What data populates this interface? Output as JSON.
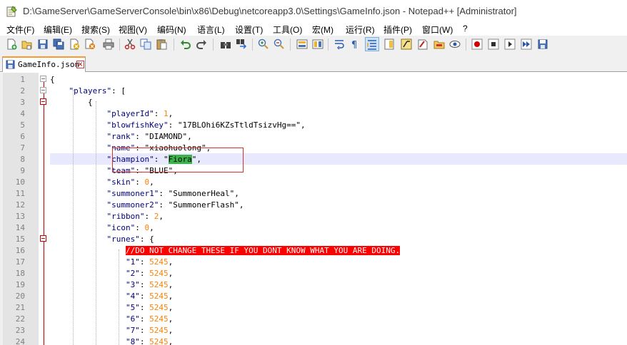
{
  "window": {
    "title": "D:\\GameServer\\GameServerConsole\\bin\\x86\\Debug\\netcoreapp3.0\\Settings\\GameInfo.json - Notepad++ [Administrator]"
  },
  "menu": [
    "文件(F)",
    "编辑(E)",
    "搜索(S)",
    "视图(V)",
    "编码(N)",
    "语言(L)",
    "设置(T)",
    "工具(O)",
    "宏(M)",
    "运行(R)",
    "插件(P)",
    "窗口(W)",
    "?"
  ],
  "toolbar": {
    "icons": [
      "new-file-icon",
      "open-file-icon",
      "save-icon",
      "save-all-icon",
      "close-icon",
      "close-all-icon",
      "print-icon",
      "cut-icon",
      "copy-icon",
      "paste-icon",
      "undo-icon",
      "redo-icon",
      "find-icon",
      "replace-icon",
      "zoom-in-icon",
      "zoom-out-icon",
      "sync-vertical-icon",
      "sync-horizontal-icon",
      "word-wrap-icon",
      "show-all-chars-icon",
      "indent-guide-icon",
      "doc-map-icon",
      "function-list-icon",
      "folder-workspace-icon",
      "monitor-icon",
      "record-macro-icon",
      "stop-macro-icon",
      "play-macro-icon",
      "run-macro-multiple-icon",
      "save-macro-icon"
    ]
  },
  "tab": {
    "label": "GameInfo.json"
  },
  "editor": {
    "lines": [
      {
        "n": "1",
        "tokens": [
          {
            "t": "{",
            "c": "s"
          }
        ]
      },
      {
        "n": "2",
        "tokens": [
          {
            "t": "    ",
            "c": "s"
          },
          {
            "t": "\"players\"",
            "c": "k"
          },
          {
            "t": ": [",
            "c": "s"
          }
        ]
      },
      {
        "n": "3",
        "tokens": [
          {
            "t": "        {",
            "c": "s"
          }
        ]
      },
      {
        "n": "4",
        "tokens": [
          {
            "t": "            ",
            "c": "s"
          },
          {
            "t": "\"playerId\"",
            "c": "k"
          },
          {
            "t": ": ",
            "c": "s"
          },
          {
            "t": "1",
            "c": "n"
          },
          {
            "t": ",",
            "c": "s"
          }
        ]
      },
      {
        "n": "5",
        "tokens": [
          {
            "t": "            ",
            "c": "s"
          },
          {
            "t": "\"blowfishKey\"",
            "c": "k"
          },
          {
            "t": ": \"17BLOhi6KZsTtldTsizvHg==\",",
            "c": "s"
          }
        ]
      },
      {
        "n": "6",
        "tokens": [
          {
            "t": "            ",
            "c": "s"
          },
          {
            "t": "\"rank\"",
            "c": "k"
          },
          {
            "t": ": \"DIAMOND\",",
            "c": "s"
          }
        ]
      },
      {
        "n": "7",
        "tokens": [
          {
            "t": "            ",
            "c": "s"
          },
          {
            "t": "\"name\"",
            "c": "k"
          },
          {
            "t": ": \"xiaohuolong\",",
            "c": "s"
          }
        ]
      },
      {
        "n": "8",
        "tokens": [
          {
            "t": "            ",
            "c": "s"
          },
          {
            "t": "\"champion\"",
            "c": "k"
          },
          {
            "t": ": \"",
            "c": "s"
          },
          {
            "t": "Fiora",
            "c": "hl"
          },
          {
            "t": "\",",
            "c": "s"
          }
        ]
      },
      {
        "n": "9",
        "tokens": [
          {
            "t": "            ",
            "c": "s"
          },
          {
            "t": "\"team\"",
            "c": "k"
          },
          {
            "t": ": \"BLUE\",",
            "c": "s"
          }
        ]
      },
      {
        "n": "10",
        "tokens": [
          {
            "t": "            ",
            "c": "s"
          },
          {
            "t": "\"skin\"",
            "c": "k"
          },
          {
            "t": ": ",
            "c": "s"
          },
          {
            "t": "0",
            "c": "n"
          },
          {
            "t": ",",
            "c": "s"
          }
        ]
      },
      {
        "n": "11",
        "tokens": [
          {
            "t": "            ",
            "c": "s"
          },
          {
            "t": "\"summoner1\"",
            "c": "k"
          },
          {
            "t": ": \"SummonerHeal\",",
            "c": "s"
          }
        ]
      },
      {
        "n": "12",
        "tokens": [
          {
            "t": "            ",
            "c": "s"
          },
          {
            "t": "\"summoner2\"",
            "c": "k"
          },
          {
            "t": ": \"SummonerFlash\",",
            "c": "s"
          }
        ]
      },
      {
        "n": "13",
        "tokens": [
          {
            "t": "            ",
            "c": "s"
          },
          {
            "t": "\"ribbon\"",
            "c": "k"
          },
          {
            "t": ": ",
            "c": "s"
          },
          {
            "t": "2",
            "c": "n"
          },
          {
            "t": ",",
            "c": "s"
          }
        ]
      },
      {
        "n": "14",
        "tokens": [
          {
            "t": "            ",
            "c": "s"
          },
          {
            "t": "\"icon\"",
            "c": "k"
          },
          {
            "t": ": ",
            "c": "s"
          },
          {
            "t": "0",
            "c": "n"
          },
          {
            "t": ",",
            "c": "s"
          }
        ]
      },
      {
        "n": "15",
        "tokens": [
          {
            "t": "            ",
            "c": "s"
          },
          {
            "t": "\"runes\"",
            "c": "k"
          },
          {
            "t": ": {",
            "c": "s"
          }
        ]
      },
      {
        "n": "16",
        "tokens": [
          {
            "t": "                ",
            "c": "s"
          },
          {
            "t": "//DO NOT CHANGE THESE IF YOU DONT KNOW WHAT YOU ARE DOING.",
            "c": "warn"
          }
        ]
      },
      {
        "n": "17",
        "tokens": [
          {
            "t": "                ",
            "c": "s"
          },
          {
            "t": "\"1\"",
            "c": "k"
          },
          {
            "t": ": ",
            "c": "s"
          },
          {
            "t": "5245",
            "c": "n"
          },
          {
            "t": ",",
            "c": "s"
          }
        ]
      },
      {
        "n": "18",
        "tokens": [
          {
            "t": "                ",
            "c": "s"
          },
          {
            "t": "\"2\"",
            "c": "k"
          },
          {
            "t": ": ",
            "c": "s"
          },
          {
            "t": "5245",
            "c": "n"
          },
          {
            "t": ",",
            "c": "s"
          }
        ]
      },
      {
        "n": "19",
        "tokens": [
          {
            "t": "                ",
            "c": "s"
          },
          {
            "t": "\"3\"",
            "c": "k"
          },
          {
            "t": ": ",
            "c": "s"
          },
          {
            "t": "5245",
            "c": "n"
          },
          {
            "t": ",",
            "c": "s"
          }
        ]
      },
      {
        "n": "20",
        "tokens": [
          {
            "t": "                ",
            "c": "s"
          },
          {
            "t": "\"4\"",
            "c": "k"
          },
          {
            "t": ": ",
            "c": "s"
          },
          {
            "t": "5245",
            "c": "n"
          },
          {
            "t": ",",
            "c": "s"
          }
        ]
      },
      {
        "n": "21",
        "tokens": [
          {
            "t": "                ",
            "c": "s"
          },
          {
            "t": "\"5\"",
            "c": "k"
          },
          {
            "t": ": ",
            "c": "s"
          },
          {
            "t": "5245",
            "c": "n"
          },
          {
            "t": ",",
            "c": "s"
          }
        ]
      },
      {
        "n": "22",
        "tokens": [
          {
            "t": "                ",
            "c": "s"
          },
          {
            "t": "\"6\"",
            "c": "k"
          },
          {
            "t": ": ",
            "c": "s"
          },
          {
            "t": "5245",
            "c": "n"
          },
          {
            "t": ",",
            "c": "s"
          }
        ]
      },
      {
        "n": "23",
        "tokens": [
          {
            "t": "                ",
            "c": "s"
          },
          {
            "t": "\"7\"",
            "c": "k"
          },
          {
            "t": ": ",
            "c": "s"
          },
          {
            "t": "5245",
            "c": "n"
          },
          {
            "t": ",",
            "c": "s"
          }
        ]
      },
      {
        "n": "24",
        "tokens": [
          {
            "t": "                ",
            "c": "s"
          },
          {
            "t": "\"8\"",
            "c": "k"
          },
          {
            "t": ": ",
            "c": "s"
          },
          {
            "t": "5245",
            "c": "n"
          },
          {
            "t": ",",
            "c": "s"
          }
        ]
      }
    ]
  },
  "colors": {
    "keyword": "#000080",
    "number": "#ff8000",
    "current_line": "#e8e8ff",
    "match_highlight": "#3cb34a",
    "warning_bg": "#ff0000",
    "tab_accent": "#fa9a31"
  }
}
